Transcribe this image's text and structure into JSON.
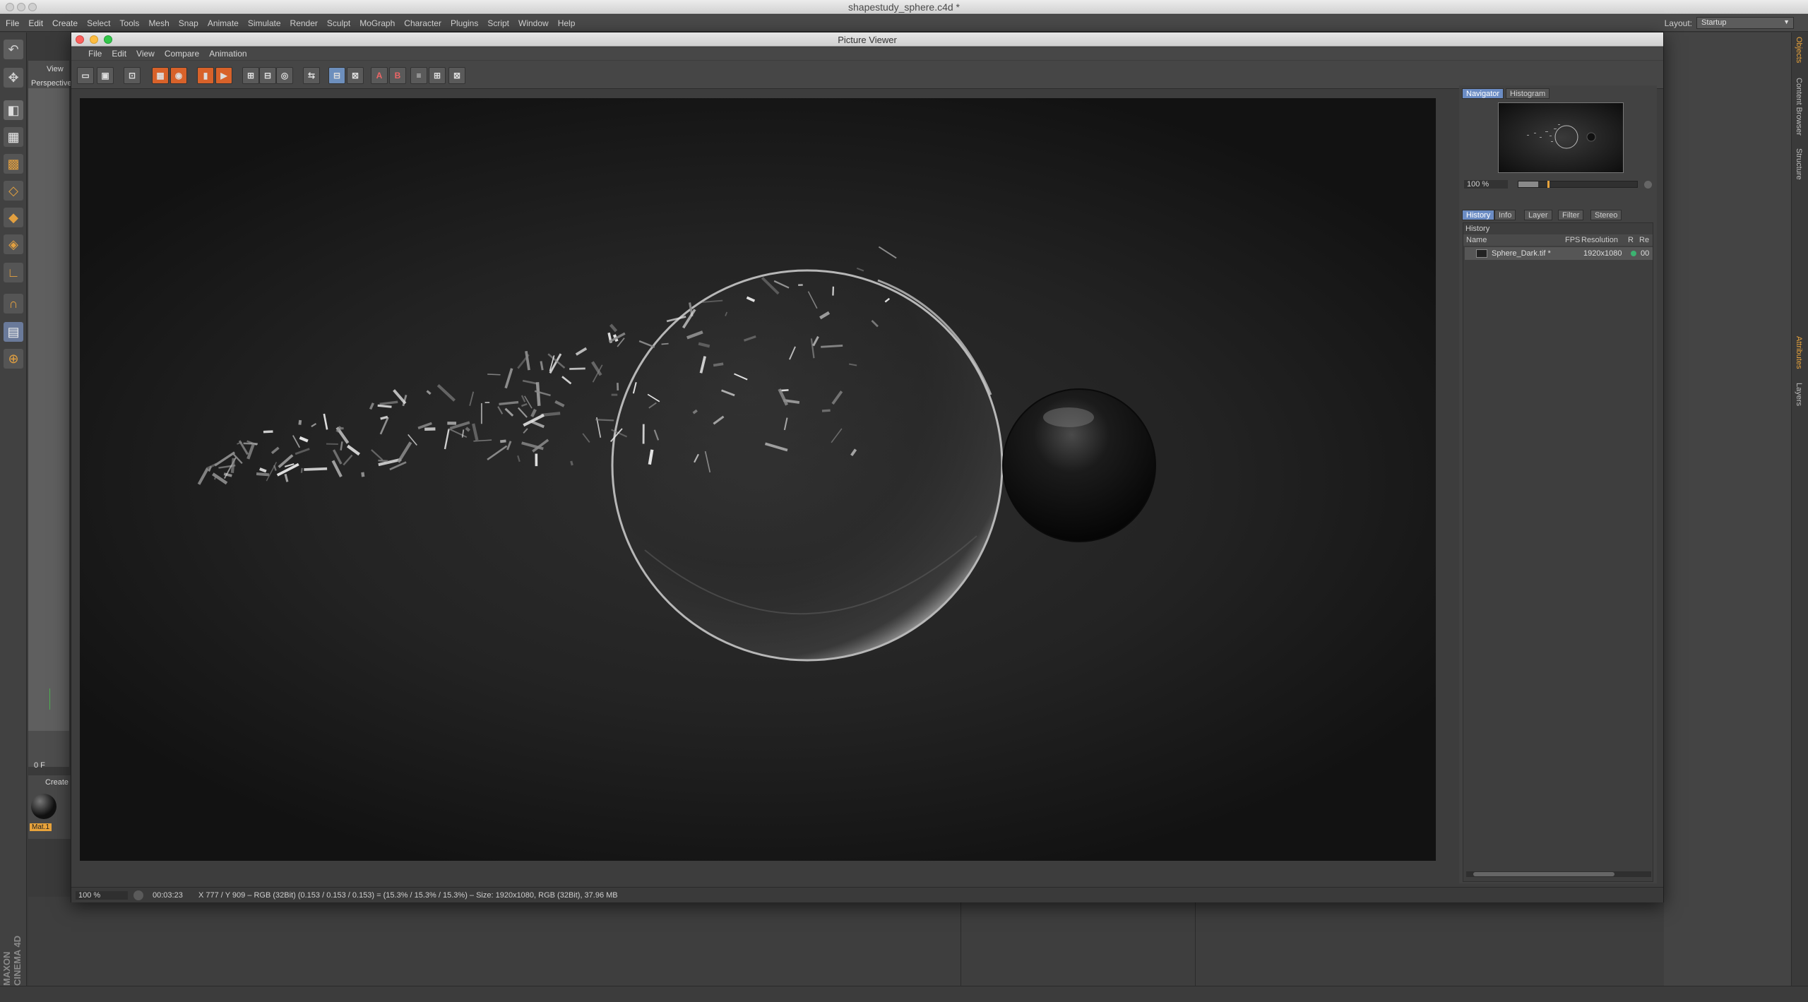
{
  "window_title": "shapestudy_sphere.c4d *",
  "main_menu": [
    "File",
    "Edit",
    "Create",
    "Select",
    "Tools",
    "Mesh",
    "Snap",
    "Animate",
    "Simulate",
    "Render",
    "Sculpt",
    "MoGraph",
    "Character",
    "Plugins",
    "Script",
    "Window",
    "Help"
  ],
  "layout": {
    "label": "Layout:",
    "value": "Startup"
  },
  "background": {
    "view_menu": "View",
    "perspective_label": "Perspective",
    "frame_label": "0 F",
    "create_label": "Create",
    "material_label": "Mat.1",
    "right_tabs": [
      "Objects",
      "Content Browser",
      "Structure",
      "Attributes",
      "Layers"
    ],
    "brand": "MAXON CINEMA 4D"
  },
  "picture_viewer": {
    "title": "Picture Viewer",
    "menu": [
      "File",
      "Edit",
      "View",
      "Compare",
      "Animation"
    ],
    "toolbar_letters": {
      "a": "A",
      "b": "B"
    },
    "side_tabs_top": [
      "Navigator",
      "Histogram"
    ],
    "zoom": "100 %",
    "side_tabs_bottom": [
      "History",
      "Info",
      "Layer",
      "Filter",
      "Stereo"
    ],
    "history": {
      "title": "History",
      "columns": [
        "Name",
        "FPS",
        "Resolution",
        "R",
        "Re"
      ],
      "rows": [
        {
          "name": "Sphere_Dark.tif *",
          "resolution": "1920x1080",
          "re": "00"
        }
      ]
    },
    "status": {
      "zoom": "100 %",
      "time": "00:03:23",
      "info": "X 777 / Y 909 – RGB (32Bit) (0.153 / 0.153 / 0.153) = (15.3% / 15.3% / 15.3%) – Size: 1920x1080, RGB (32Bit), 37.96 MB"
    }
  },
  "colors": {
    "accent_orange": "#d8622a",
    "tab_blue": "#6b8cc4",
    "status_green": "#3cb371"
  }
}
